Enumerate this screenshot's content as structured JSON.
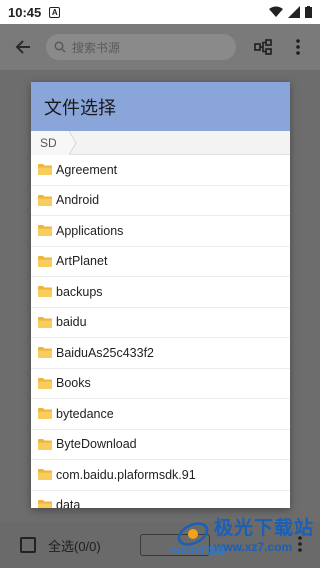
{
  "status_bar": {
    "time": "10:45",
    "notification_letter": "A"
  },
  "app_bar": {
    "search_placeholder": "搜索书源"
  },
  "bottom_bar": {
    "select_all_label": "全选(0/0)"
  },
  "dialog": {
    "title": "文件选择",
    "breadcrumb": [
      "SD"
    ],
    "header_color": "#8aa5d9",
    "folders": [
      "Agreement",
      "Android",
      "Applications",
      "ArtPlanet",
      "backups",
      "baidu",
      "BaiduAs25c433f2",
      "Books",
      "bytedance",
      "ByteDownload",
      "com.baidu.plaformsdk.91",
      "data"
    ]
  },
  "watermark": {
    "title": "极光下载站",
    "url": "www.xz7.com",
    "small": "GOGO手游网"
  }
}
